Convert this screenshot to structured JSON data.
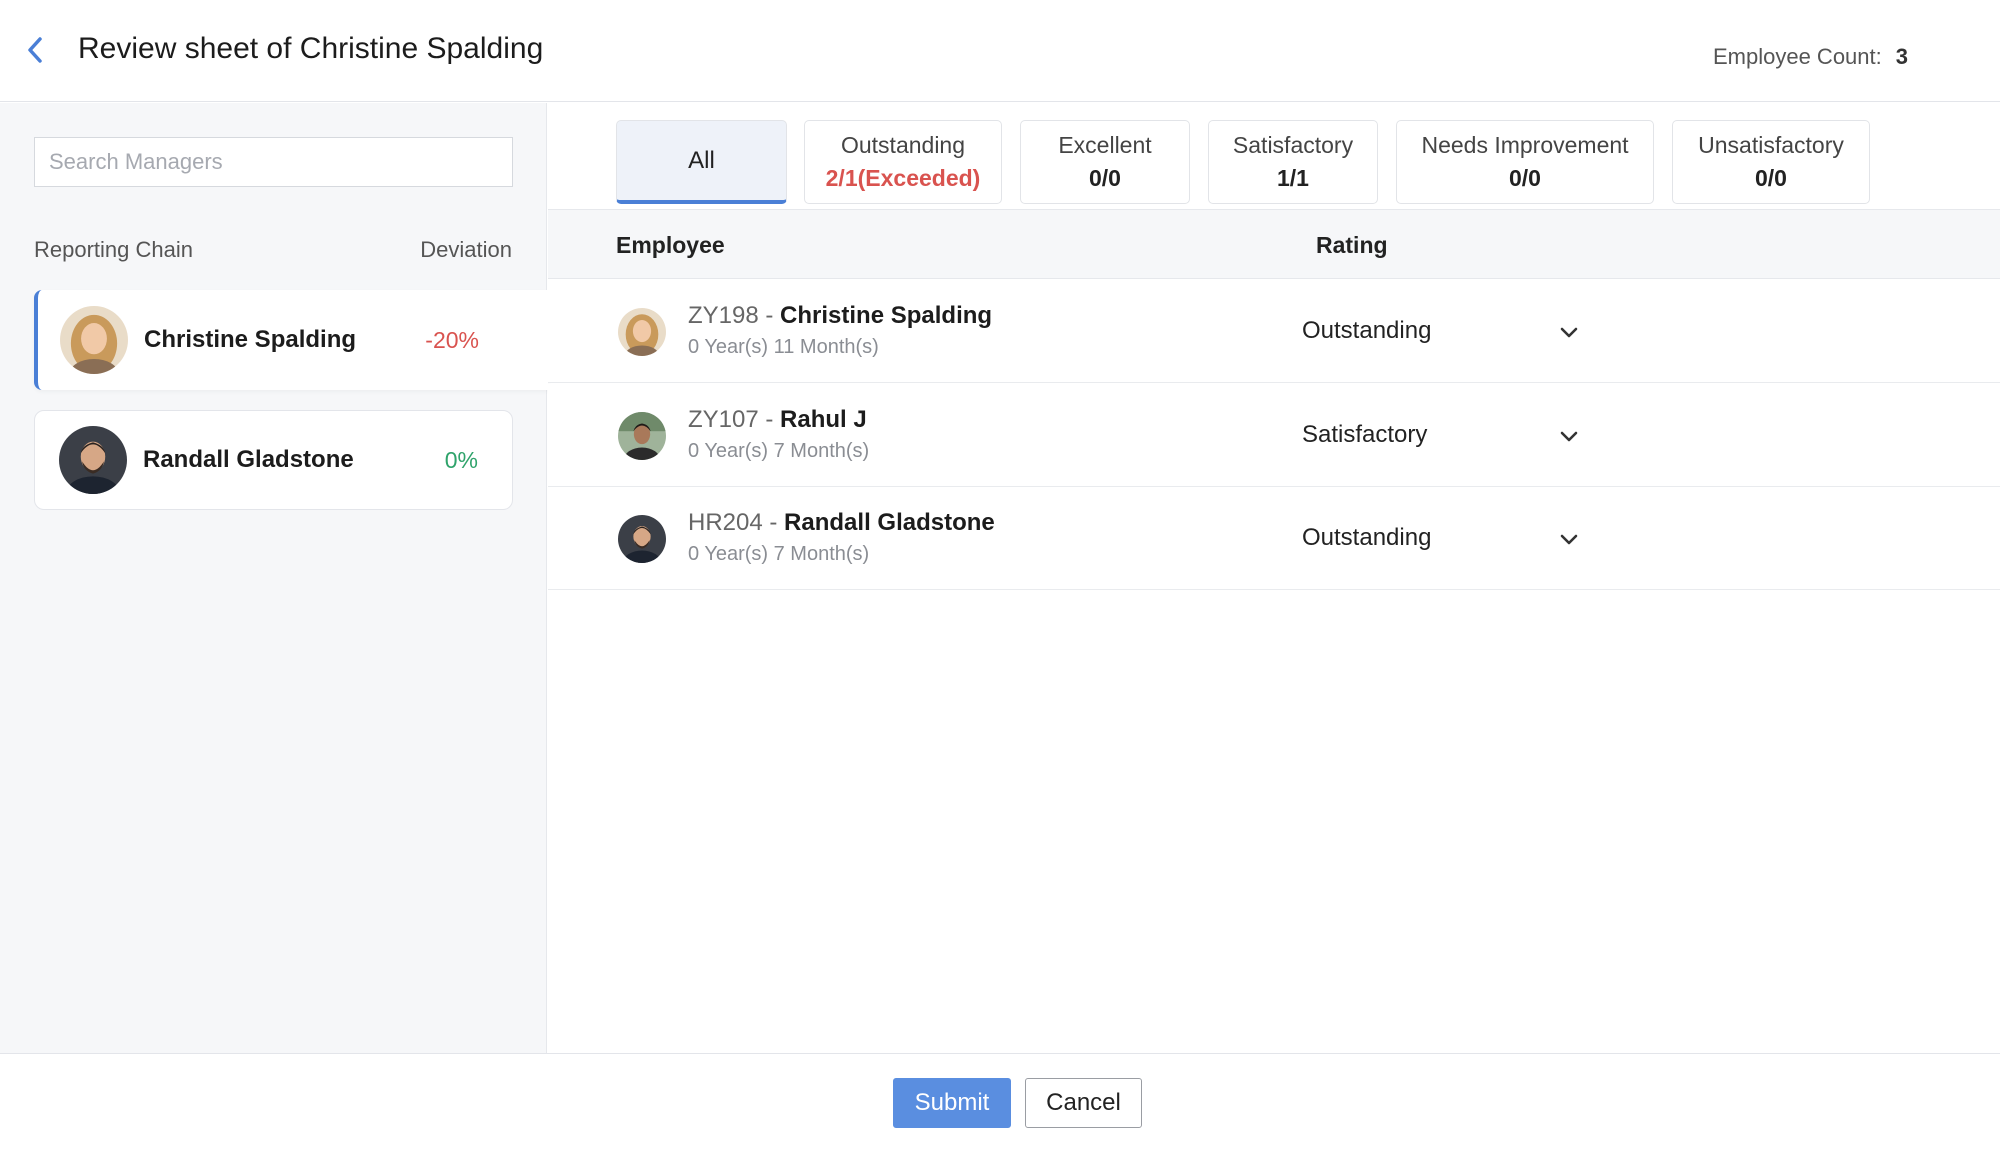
{
  "header": {
    "title": "Review sheet of Christine Spalding",
    "employee_count_label": "Employee Count:",
    "employee_count_value": "3"
  },
  "sidebar": {
    "search_placeholder": "Search Managers",
    "chain_heading": "Reporting Chain",
    "deviation_heading": "Deviation",
    "managers": [
      {
        "name": "Christine Spalding",
        "deviation": "-20%",
        "selected": true
      },
      {
        "name": "Randall Gladstone",
        "deviation": "0%",
        "selected": false
      }
    ]
  },
  "tabs": [
    {
      "label": "All",
      "count": ""
    },
    {
      "label": "Outstanding",
      "count": "2/1(Exceeded)"
    },
    {
      "label": "Excellent",
      "count": "0/0"
    },
    {
      "label": "Satisfactory",
      "count": "1/1"
    },
    {
      "label": "Needs Improvement",
      "count": "0/0"
    },
    {
      "label": "Unsatisfactory",
      "count": "0/0"
    }
  ],
  "table": {
    "col_employee": "Employee",
    "col_rating": "Rating",
    "rows": [
      {
        "id": "ZY198 - ",
        "name": "Christine Spalding",
        "tenure": "0 Year(s) 11 Month(s)",
        "rating": "Outstanding"
      },
      {
        "id": "ZY107 - ",
        "name": "Rahul J",
        "tenure": "0 Year(s) 7 Month(s)",
        "rating": "Satisfactory"
      },
      {
        "id": "HR204 - ",
        "name": "Randall Gladstone",
        "tenure": "0 Year(s) 7 Month(s)",
        "rating": "Outstanding"
      }
    ]
  },
  "footer": {
    "submit_label": "Submit",
    "cancel_label": "Cancel"
  },
  "colors": {
    "accent": "#4a7fd6",
    "negative": "#d9534f",
    "positive": "#2fa36b",
    "submit_bg": "#5a8ee0"
  },
  "icons": {
    "back": "chevron-left-icon",
    "dropdown": "chevron-down-icon",
    "avatar": "person-avatar-icon"
  }
}
